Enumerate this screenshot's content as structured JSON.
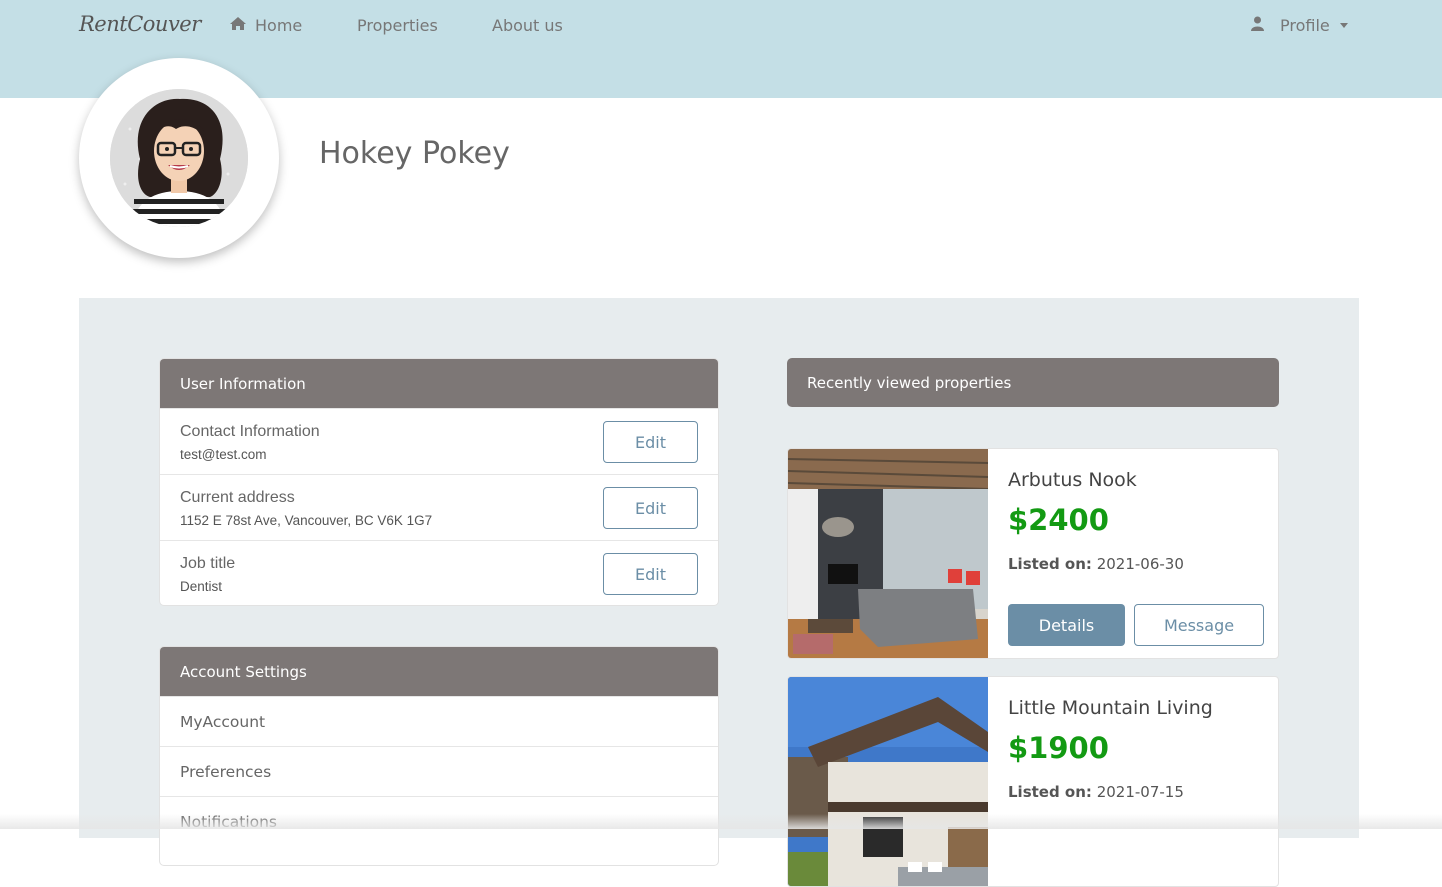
{
  "navbar": {
    "brand": "RentCouver",
    "links": [
      {
        "label": "Home",
        "icon": "home-icon"
      },
      {
        "label": "Properties"
      },
      {
        "label": "About us"
      }
    ],
    "profile_label": "Profile",
    "profile_icon": "user-icon"
  },
  "profile": {
    "name": "Hokey Pokey"
  },
  "user_info": {
    "header": "User Information",
    "rows": [
      {
        "label": "Contact Information",
        "value": "test@test.com",
        "button": "Edit"
      },
      {
        "label": "Current address",
        "value": "1152 E 78st Ave, Vancouver, BC V6K 1G7",
        "button": "Edit"
      },
      {
        "label": "Job title",
        "value": "Dentist",
        "button": "Edit"
      }
    ]
  },
  "account_settings": {
    "header": "Account Settings",
    "items": [
      "MyAccount",
      "Preferences",
      "Notifications"
    ]
  },
  "recent": {
    "header": "Recently viewed properties",
    "listed_label": "Listed on:",
    "details_label": "Details",
    "message_label": "Message",
    "properties": [
      {
        "name": "Arbutus Nook",
        "price": "$2400",
        "listed": "2021-06-30"
      },
      {
        "name": "Little Mountain Living",
        "price": "$1900",
        "listed": "2021-07-15"
      }
    ]
  },
  "colors": {
    "navbar_bg": "#c4dfe6",
    "card_header_bg": "#7d7776",
    "accent": "#6b8ea6",
    "price_green": "#139a13",
    "panel_bg": "#e7ecee"
  }
}
